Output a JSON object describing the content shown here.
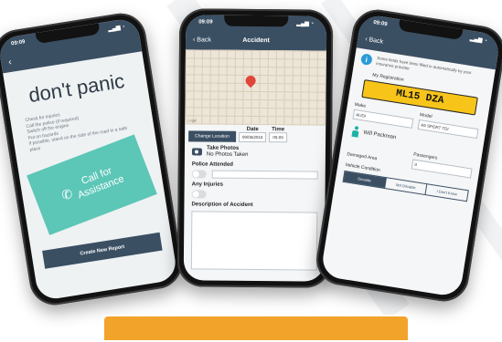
{
  "phone1": {
    "time": "09:09",
    "heading": "don't panic",
    "instructions": [
      "Check for injuries",
      "Call the police (if required)",
      "Switch off the engine",
      "Put on hazards",
      "If possible, stand on the side of the road in a safe place"
    ],
    "call_button_lines": [
      "Call for",
      "Assistance"
    ],
    "create_button": "Create New Report"
  },
  "phone2": {
    "time": "09:09",
    "nav_back": "Back",
    "nav_title": "Accident",
    "change_location": "Change Location",
    "date_label": "Date",
    "date_value": "09/08/2018",
    "time_label": "Time",
    "time_value": "09:09",
    "take_photos": "Take Photos",
    "no_photos": "No Photos Taken",
    "police_attended": "Police Attended",
    "any_injuries": "Any Injuries",
    "description": "Description of Accident"
  },
  "phone3": {
    "time": "09:09",
    "nav_back": "Back",
    "info_text": "Some fields have been filled in automatically by your insurance provider",
    "reg_label": "My Registration",
    "plate": "ML15 DZA",
    "make_label": "Make",
    "make_value": "AUDI",
    "model_label": "Model",
    "model_value": "A5 SPORT TDI",
    "user_name": "Will Packman",
    "damaged_area": "Damaged Area",
    "passengers": "Passengers",
    "passengers_value": "0",
    "vehicle_condition": "Vehicle Condition",
    "segments": [
      "Drivable",
      "Not Drivable",
      "I Don't Know"
    ]
  },
  "colors": {
    "navy": "#3b4f63",
    "teal": "#5cc6b7",
    "plate_yellow": "#f7c41a",
    "pin_red": "#e0453a",
    "banner_orange": "#f2a329"
  }
}
